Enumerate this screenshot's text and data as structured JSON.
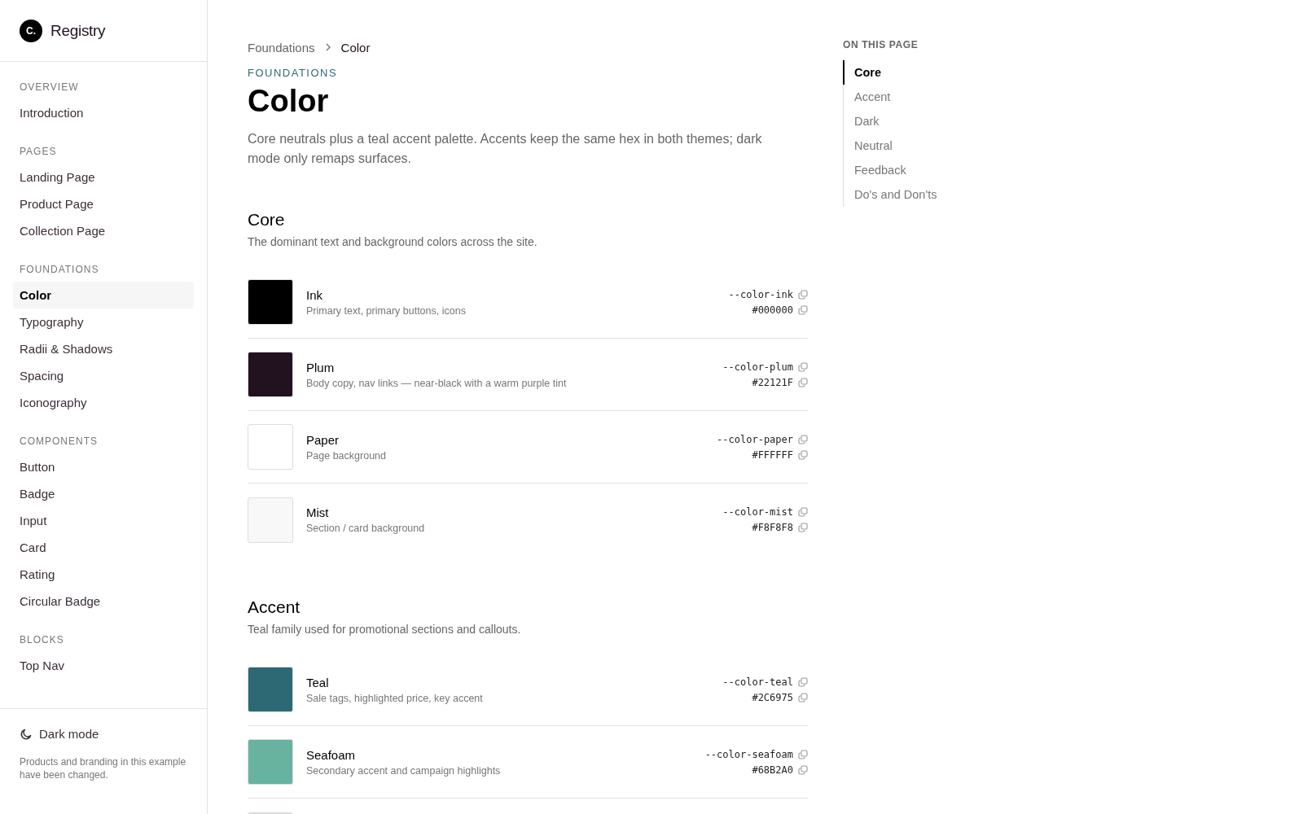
{
  "brand": {
    "mark": "C.",
    "name": "Registry"
  },
  "sidebar": {
    "sections": [
      {
        "heading": "OVERVIEW",
        "items": [
          {
            "label": "Introduction",
            "selected": false
          }
        ]
      },
      {
        "heading": "PAGES",
        "items": [
          {
            "label": "Landing Page",
            "selected": false
          },
          {
            "label": "Product Page",
            "selected": false
          },
          {
            "label": "Collection Page",
            "selected": false
          }
        ]
      },
      {
        "heading": "FOUNDATIONS",
        "items": [
          {
            "label": "Color",
            "selected": true
          },
          {
            "label": "Typography",
            "selected": false
          },
          {
            "label": "Radii & Shadows",
            "selected": false
          },
          {
            "label": "Spacing",
            "selected": false
          },
          {
            "label": "Iconography",
            "selected": false
          }
        ]
      },
      {
        "heading": "COMPONENTS",
        "items": [
          {
            "label": "Button",
            "selected": false
          },
          {
            "label": "Badge",
            "selected": false
          },
          {
            "label": "Input",
            "selected": false
          },
          {
            "label": "Card",
            "selected": false
          },
          {
            "label": "Rating",
            "selected": false
          },
          {
            "label": "Circular Badge",
            "selected": false
          }
        ]
      },
      {
        "heading": "BLOCKS",
        "items": [
          {
            "label": "Top Nav",
            "selected": false
          }
        ]
      }
    ],
    "dark_mode": {
      "label": "Dark mode",
      "on": false
    },
    "footnote": "Products and branding in this example have been changed."
  },
  "breadcrumb": [
    {
      "label": "Foundations"
    },
    {
      "label": "Color"
    }
  ],
  "eyebrow": "FOUNDATIONS",
  "title": "Color",
  "intro": "Core neutrals plus a teal accent palette. Accents keep the same hex in both themes; dark mode only remaps surfaces.",
  "groups": [
    {
      "title": "Core",
      "description": "The dominant text and background colors across the site.",
      "swatches": [
        {
          "name": "Ink",
          "usage": "Primary text, primary buttons, icons",
          "token": "--color-ink",
          "hex": "#000000",
          "color": "#000000"
        },
        {
          "name": "Plum",
          "usage": "Body copy, nav links — near-black with a warm purple tint",
          "token": "--color-plum",
          "hex": "#22121F",
          "color": "#22121f"
        },
        {
          "name": "Paper",
          "usage": "Page background",
          "token": "--color-paper",
          "hex": "#FFFFFF",
          "color": "#ffffff"
        },
        {
          "name": "Mist",
          "usage": "Section / card background",
          "token": "--color-mist",
          "hex": "#F8F8F8",
          "color": "#f8f8f8"
        }
      ]
    },
    {
      "title": "Accent",
      "description": "Teal family used for promotional sections and callouts.",
      "swatches": [
        {
          "name": "Teal",
          "usage": "Sale tags, highlighted price, key accent",
          "token": "--color-teal",
          "hex": "#2C6975",
          "color": "#2c6975"
        },
        {
          "name": "Seafoam",
          "usage": "Secondary accent and campaign highlights",
          "token": "--color-seafoam",
          "hex": "#68B2A0",
          "color": "#68b2a0"
        },
        {
          "color": "#cde0c9"
        }
      ]
    }
  ],
  "toc": {
    "heading": "ON THIS PAGE",
    "items": [
      {
        "label": "Core",
        "selected": true
      },
      {
        "label": "Accent",
        "selected": false
      },
      {
        "label": "Dark",
        "selected": false
      },
      {
        "label": "Neutral",
        "selected": false
      },
      {
        "label": "Feedback",
        "selected": false
      },
      {
        "label": "Do's and Don'ts",
        "selected": false
      }
    ]
  }
}
